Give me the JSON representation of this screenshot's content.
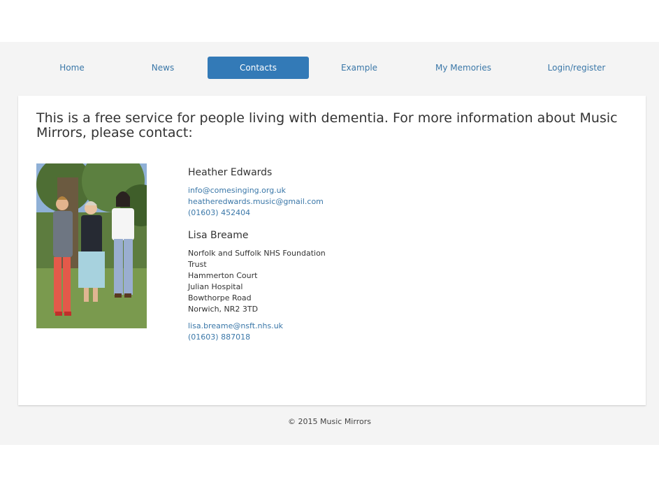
{
  "nav": {
    "items": [
      {
        "label": "Home"
      },
      {
        "label": "News"
      },
      {
        "label": "Contacts"
      },
      {
        "label": "Example"
      },
      {
        "label": "My Memories"
      },
      {
        "label": "Login/register"
      }
    ],
    "active": "Contacts"
  },
  "intro": "This is a free service for people living with dementia. For more information about Music Mirrors, please contact:",
  "contacts": [
    {
      "name": "Heather Edwards",
      "email1": "info@comesinging.org.uk",
      "email2": "heatheredwards.music@gmail.com",
      "phone": "(01603) 452404"
    },
    {
      "name": "Lisa Breame",
      "address": [
        "Norfolk and Suffolk NHS Foundation",
        "Trust",
        "Hammerton Court",
        "Julian Hospital",
        "Bowthorpe Road",
        "Norwich, NR2 3TD"
      ],
      "email": "lisa.breame@nsft.nhs.uk",
      "phone": "(01603) 887018"
    }
  ],
  "footer": "© 2015 Music Mirrors",
  "colors": {
    "accent": "#337ab7",
    "link": "#3a77a8",
    "band": "#f4f4f4"
  }
}
